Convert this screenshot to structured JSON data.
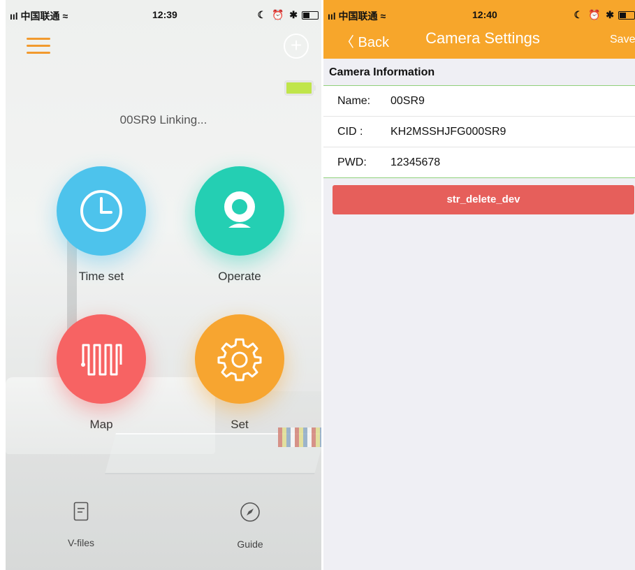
{
  "left_screen": {
    "status": {
      "carrier": "ııl 中国联通 ≈",
      "time": "12:39",
      "icons": "☾ ⏰ ✱"
    },
    "camera_status": "00SR9 Linking...",
    "tiles": [
      {
        "label": "Time set",
        "icon": "clock-icon",
        "color": "#4dc3ec"
      },
      {
        "label": "Operate",
        "icon": "webcam-icon",
        "color": "#24cfb3"
      },
      {
        "label": "Map",
        "icon": "path-icon",
        "color": "#f76363"
      },
      {
        "label": "Set",
        "icon": "gear-icon",
        "color": "#f7a530"
      }
    ],
    "bottom_nav": [
      {
        "label": "V-files",
        "icon": "file-icon"
      },
      {
        "label": "Guide",
        "icon": "compass-icon"
      }
    ],
    "plus_symbol": "+",
    "accent": "#f29a2e"
  },
  "right_screen": {
    "status": {
      "carrier": "ııl 中国联通 ≈",
      "time": "12:40",
      "icons": "☾ ⏰ ✱"
    },
    "nav": {
      "back": "〈 Back",
      "title": "Camera Settings",
      "save": "Save"
    },
    "section_title": "Camera Information",
    "fields": [
      {
        "key": "Name:",
        "value": "00SR9"
      },
      {
        "key": "CID :",
        "value": "KH2MSSHJFG000SR9"
      },
      {
        "key": "PWD:",
        "value": "12345678"
      }
    ],
    "delete_button": "str_delete_dev",
    "header_color": "#f7a62b",
    "delete_color": "#e65f5b"
  }
}
